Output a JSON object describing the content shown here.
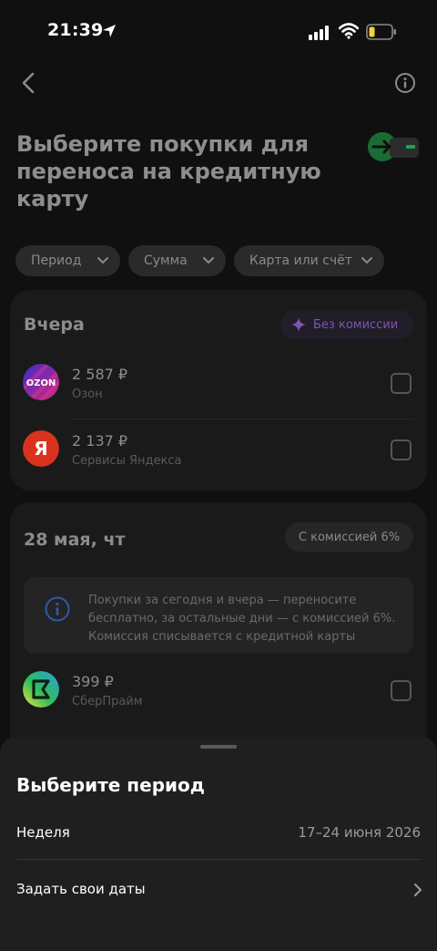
{
  "status_bar": {
    "time": "21:39"
  },
  "header": {
    "title": "Выберите покупки для переноса на кредитную карту"
  },
  "filters": [
    {
      "label": "Период"
    },
    {
      "label": "Сумма"
    },
    {
      "label": "Карта или счёт"
    }
  ],
  "groups": [
    {
      "title": "Вчера",
      "badge": "Без комиссии",
      "items": [
        {
          "amount": "2 587 ₽",
          "merchant": "Озон",
          "logo_text": "OZON",
          "logo_color": "#3b2fd0"
        },
        {
          "amount": "2 137 ₽",
          "merchant": "Сервисы Яндекса",
          "logo_text": "Я",
          "logo_color": "#d9331f"
        }
      ]
    },
    {
      "title": "28 мая, чт",
      "badge": "С комиссией 6%",
      "notice": "Покупки за сегодня и вчера — переносите бесплатно, за остальные дни — с комиссией 6%. Комиссия списывается с кредитной карты",
      "items": [
        {
          "amount": "399 ₽",
          "merchant": "СберПрайм"
        }
      ]
    }
  ],
  "sheet": {
    "title": "Выберите период",
    "options": [
      {
        "label": "Неделя",
        "value": "17–24 июня 2026"
      },
      {
        "label": "Задать свои даты"
      }
    ]
  },
  "colors": {
    "accent_purple": "#7d55b3",
    "brand_green": "#1fa34a",
    "info_blue": "#2f5aa8"
  }
}
